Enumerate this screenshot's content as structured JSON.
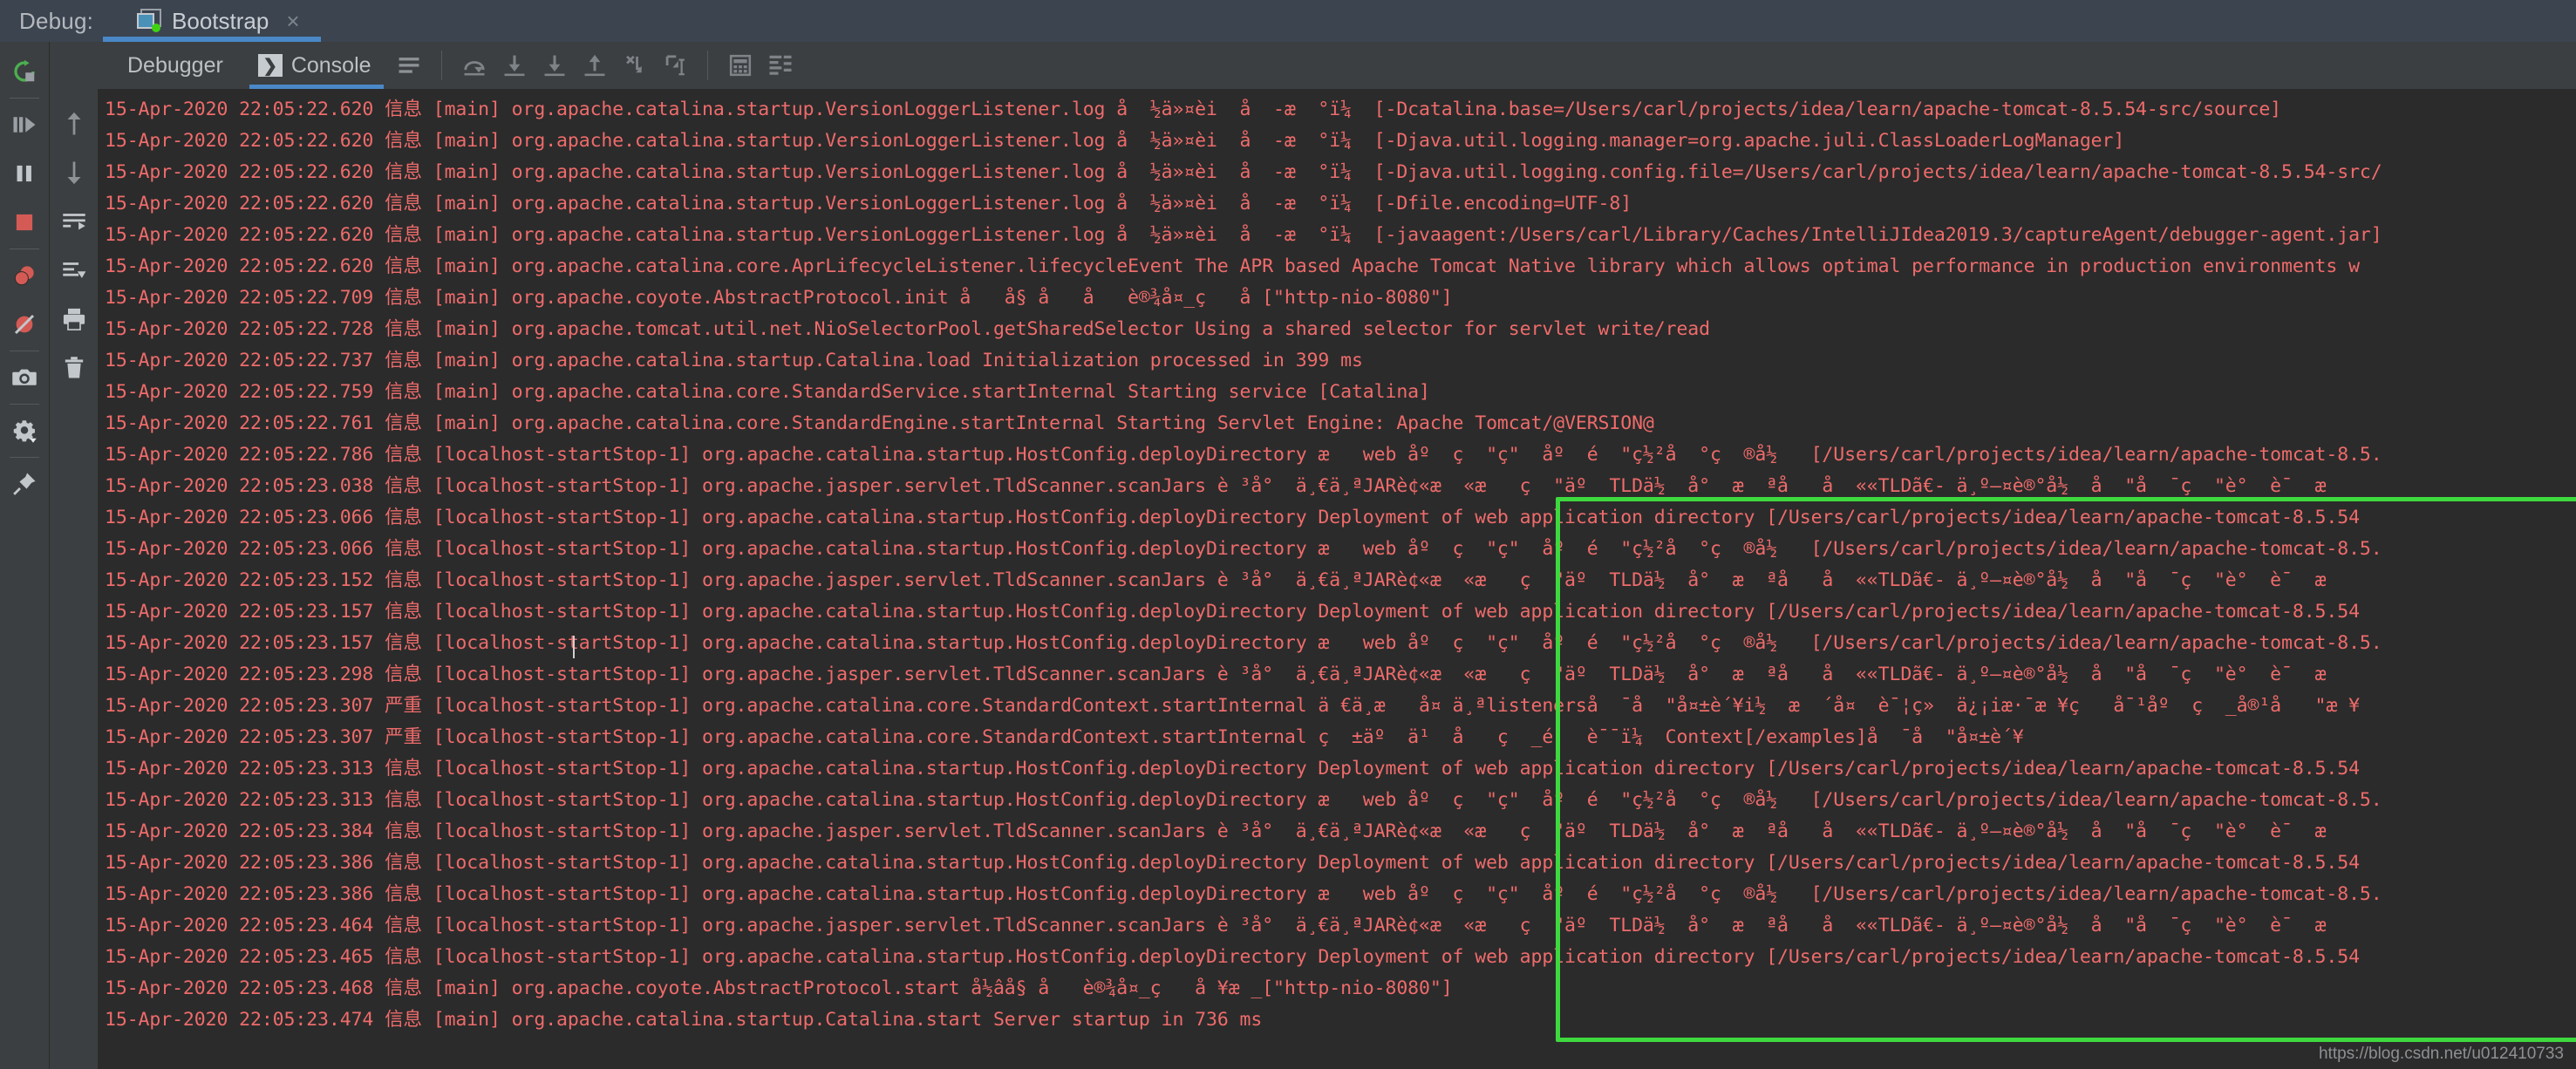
{
  "header": {
    "debug_label": "Debug:",
    "session_tab": {
      "name": "Bootstrap",
      "close": "×",
      "icon": "debug-session-icon",
      "status_dot_color": "#3fd211"
    },
    "accent_color": "#4a88c7",
    "background": "#3c4450"
  },
  "left_rail": {
    "items": [
      {
        "name": "rerun-icon",
        "label": "Rerun"
      },
      {
        "name": "resume-program-icon",
        "label": "Resume Program"
      },
      {
        "name": "pause-program-icon",
        "label": "Pause Program"
      },
      {
        "name": "stop-icon",
        "label": "Stop"
      },
      {
        "name": "view-breakpoints-icon",
        "label": "View Breakpoints"
      },
      {
        "name": "mute-breakpoints-icon",
        "label": "Mute Breakpoints"
      },
      {
        "name": "camera-icon",
        "label": "Get Thread Dump"
      },
      {
        "name": "settings-gear-icon",
        "label": "Settings"
      },
      {
        "name": "pin-icon",
        "label": "Pin Tab"
      }
    ]
  },
  "console_gutter": {
    "items": [
      {
        "name": "scroll-up-icon",
        "label": "Up the Stack Trace"
      },
      {
        "name": "scroll-down-icon",
        "label": "Down the Stack Trace"
      },
      {
        "name": "soft-wrap-icon",
        "label": "Use Soft Wraps"
      },
      {
        "name": "scroll-to-end-icon",
        "label": "Scroll to the End"
      },
      {
        "name": "print-icon",
        "label": "Print"
      },
      {
        "name": "trash-icon",
        "label": "Clear All"
      }
    ]
  },
  "toolbar": {
    "tabs": [
      {
        "label": "Debugger",
        "active": false,
        "name": "tab-debugger"
      },
      {
        "label": "Console",
        "active": true,
        "name": "tab-console",
        "glyph": "❯"
      }
    ],
    "buttons": [
      {
        "name": "console-options-icon",
        "label": "Console Options"
      },
      {
        "name": "step-over-icon",
        "label": "Step Over"
      },
      {
        "name": "step-into-icon",
        "label": "Step Into"
      },
      {
        "name": "force-step-into-icon",
        "label": "Force Step Into"
      },
      {
        "name": "step-out-icon",
        "label": "Step Out"
      },
      {
        "name": "drop-frame-icon",
        "label": "Drop Frame"
      },
      {
        "name": "run-to-cursor-icon",
        "label": "Run to Cursor"
      },
      {
        "name": "evaluate-expression-icon",
        "label": "Evaluate Expression"
      },
      {
        "name": "trace-current-stream-icon",
        "label": "Trace Current Stream Chain"
      }
    ]
  },
  "console": {
    "text_color": "#ef6b6b",
    "background": "#2b2b2b",
    "lines": [
      "15-Apr-2020 22:05:22.620 信息 [main] org.apache.catalina.startup.VersionLoggerListener.log å  ½ä»¤èi  å  -æ  °ï¼  [-Dcatalina.base=/Users/carl/projects/idea/learn/apache-tomcat-8.5.54-src/source]",
      "15-Apr-2020 22:05:22.620 信息 [main] org.apache.catalina.startup.VersionLoggerListener.log å  ½ä»¤èi  å  -æ  °ï¼  [-Djava.util.logging.manager=org.apache.juli.ClassLoaderLogManager]",
      "15-Apr-2020 22:05:22.620 信息 [main] org.apache.catalina.startup.VersionLoggerListener.log å  ½ä»¤èi  å  -æ  °ï¼  [-Djava.util.logging.config.file=/Users/carl/projects/idea/learn/apache-tomcat-8.5.54-src/",
      "15-Apr-2020 22:05:22.620 信息 [main] org.apache.catalina.startup.VersionLoggerListener.log å  ½ä»¤èi  å  -æ  °ï¼  [-Dfile.encoding=UTF-8]",
      "15-Apr-2020 22:05:22.620 信息 [main] org.apache.catalina.startup.VersionLoggerListener.log å  ½ä»¤èi  å  -æ  °ï¼  [-javaagent:/Users/carl/Library/Caches/IntelliJIdea2019.3/captureAgent/debugger-agent.jar]",
      "15-Apr-2020 22:05:22.620 信息 [main] org.apache.catalina.core.AprLifecycleListener.lifecycleEvent The APR based Apache Tomcat Native library which allows optimal performance in production environments w",
      "15-Apr-2020 22:05:22.709 信息 [main] org.apache.coyote.AbstractProtocol.init å   å§ å   å   è®¾å¤_ç   å [\"http-nio-8080\"]",
      "15-Apr-2020 22:05:22.728 信息 [main] org.apache.tomcat.util.net.NioSelectorPool.getSharedSelector Using a shared selector for servlet write/read",
      "15-Apr-2020 22:05:22.737 信息 [main] org.apache.catalina.startup.Catalina.load Initialization processed in 399 ms",
      "15-Apr-2020 22:05:22.759 信息 [main] org.apache.catalina.core.StandardService.startInternal Starting service [Catalina]",
      "15-Apr-2020 22:05:22.761 信息 [main] org.apache.catalina.core.StandardEngine.startInternal Starting Servlet Engine: Apache Tomcat/@VERSION@",
      "15-Apr-2020 22:05:22.786 信息 [localhost-startStop-1] org.apache.catalina.startup.HostConfig.deployDirectory æ   web åº  ç  \"ç\"  åº  é  \"ç½²å  °ç  ®å½   [/Users/carl/projects/idea/learn/apache-tomcat-8.5.",
      "15-Apr-2020 22:05:23.038 信息 [localhost-startStop-1] org.apache.jasper.servlet.TldScanner.scanJars è ³å°  ä¸€ä¸ªJARè¢«æ  «æ   ç  \"äº  TLDä½  å°  æ  ªå   å  ««TLDã€- ä¸º–¤è®°å½  å  \"å  ¯ç  \"è°  è¯  æ",
      "15-Apr-2020 22:05:23.066 信息 [localhost-startStop-1] org.apache.catalina.startup.HostConfig.deployDirectory Deployment of web application directory [/Users/carl/projects/idea/learn/apache-tomcat-8.5.54",
      "15-Apr-2020 22:05:23.066 信息 [localhost-startStop-1] org.apache.catalina.startup.HostConfig.deployDirectory æ   web åº  ç  \"ç\"  åº  é  \"ç½²å  °ç  ®å½   [/Users/carl/projects/idea/learn/apache-tomcat-8.5.",
      "15-Apr-2020 22:05:23.152 信息 [localhost-startStop-1] org.apache.jasper.servlet.TldScanner.scanJars è ³å°  ä¸€ä¸ªJARè¢«æ  «æ   ç  \"äº  TLDä½  å°  æ  ªå   å  ««TLDã€- ä¸º–¤è®°å½  å  \"å  ¯ç  \"è°  è¯  æ",
      "15-Apr-2020 22:05:23.157 信息 [localhost-startStop-1] org.apache.catalina.startup.HostConfig.deployDirectory Deployment of web application directory [/Users/carl/projects/idea/learn/apache-tomcat-8.5.54",
      "15-Apr-2020 22:05:23.157 信息 [localhost-startStop-1] org.apache.catalina.startup.HostConfig.deployDirectory æ   web åº  ç  \"ç\"  åº  é  \"ç½²å  °ç  ®å½   [/Users/carl/projects/idea/learn/apache-tomcat-8.5.",
      "15-Apr-2020 22:05:23.298 信息 [localhost-startStop-1] org.apache.jasper.servlet.TldScanner.scanJars è ³å°  ä¸€ä¸ªJARè¢«æ  «æ   ç  \"äº  TLDä½  å°  æ  ªå   å  ««TLDã€- ä¸º–¤è®°å½  å  \"å  ¯ç  \"è°  è¯  æ",
      "15-Apr-2020 22:05:23.307 严重 [localhost-startStop-1] org.apache.catalina.core.StandardContext.startInternal ä €ä¸æ   å¤ ä¸ªlistenerså  ¯å  \"å¤±è´¥i½  æ  ´å¤  è¯¦ç»  ä¿¡iæ·¯æ ¥ç   å¯¹åº  ç  _å®¹å   \"æ ¥",
      "15-Apr-2020 22:05:23.307 严重 [localhost-startStop-1] org.apache.catalina.core.StandardContext.startInternal ç  ±äº  ä¹  å   ç  _é   è¯¯ï¼  Context[/examples]å  ¯å  \"å¤±è´¥",
      "15-Apr-2020 22:05:23.313 信息 [localhost-startStop-1] org.apache.catalina.startup.HostConfig.deployDirectory Deployment of web application directory [/Users/carl/projects/idea/learn/apache-tomcat-8.5.54",
      "15-Apr-2020 22:05:23.313 信息 [localhost-startStop-1] org.apache.catalina.startup.HostConfig.deployDirectory æ   web åº  ç  \"ç\"  åº  é  \"ç½²å  °ç  ®å½   [/Users/carl/projects/idea/learn/apache-tomcat-8.5.",
      "15-Apr-2020 22:05:23.384 信息 [localhost-startStop-1] org.apache.jasper.servlet.TldScanner.scanJars è ³å°  ä¸€ä¸ªJARè¢«æ  «æ   ç  \"äº  TLDä½  å°  æ  ªå   å  ««TLDã€- ä¸º–¤è®°å½  å  \"å  ¯ç  \"è°  è¯  æ",
      "15-Apr-2020 22:05:23.386 信息 [localhost-startStop-1] org.apache.catalina.startup.HostConfig.deployDirectory Deployment of web application directory [/Users/carl/projects/idea/learn/apache-tomcat-8.5.54",
      "15-Apr-2020 22:05:23.386 信息 [localhost-startStop-1] org.apache.catalina.startup.HostConfig.deployDirectory æ   web åº  ç  \"ç\"  åº  é  \"ç½²å  °ç  ®å½   [/Users/carl/projects/idea/learn/apache-tomcat-8.5.",
      "15-Apr-2020 22:05:23.464 信息 [localhost-startStop-1] org.apache.jasper.servlet.TldScanner.scanJars è ³å°  ä¸€ä¸ªJARè¢«æ  «æ   ç  \"äº  TLDä½  å°  æ  ªå   å  ««TLDã€- ä¸º–¤è®°å½  å  \"å  ¯ç  \"è°  è¯  æ",
      "15-Apr-2020 22:05:23.465 信息 [localhost-startStop-1] org.apache.catalina.startup.HostConfig.deployDirectory Deployment of web application directory [/Users/carl/projects/idea/learn/apache-tomcat-8.5.54",
      "15-Apr-2020 22:05:23.468 信息 [main] org.apache.coyote.AbstractProtocol.start å½âå§ å   è®¾å¤_ç   å ¥æ _[\"http-nio-8080\"]",
      "15-Apr-2020 22:05:23.474 信息 [main] org.apache.catalina.startup.Catalina.start Server startup in 736 ms"
    ]
  },
  "annotation": {
    "green_box_color": "#3ed93e"
  },
  "watermark": {
    "text": "https://blog.csdn.net/u012410733"
  }
}
